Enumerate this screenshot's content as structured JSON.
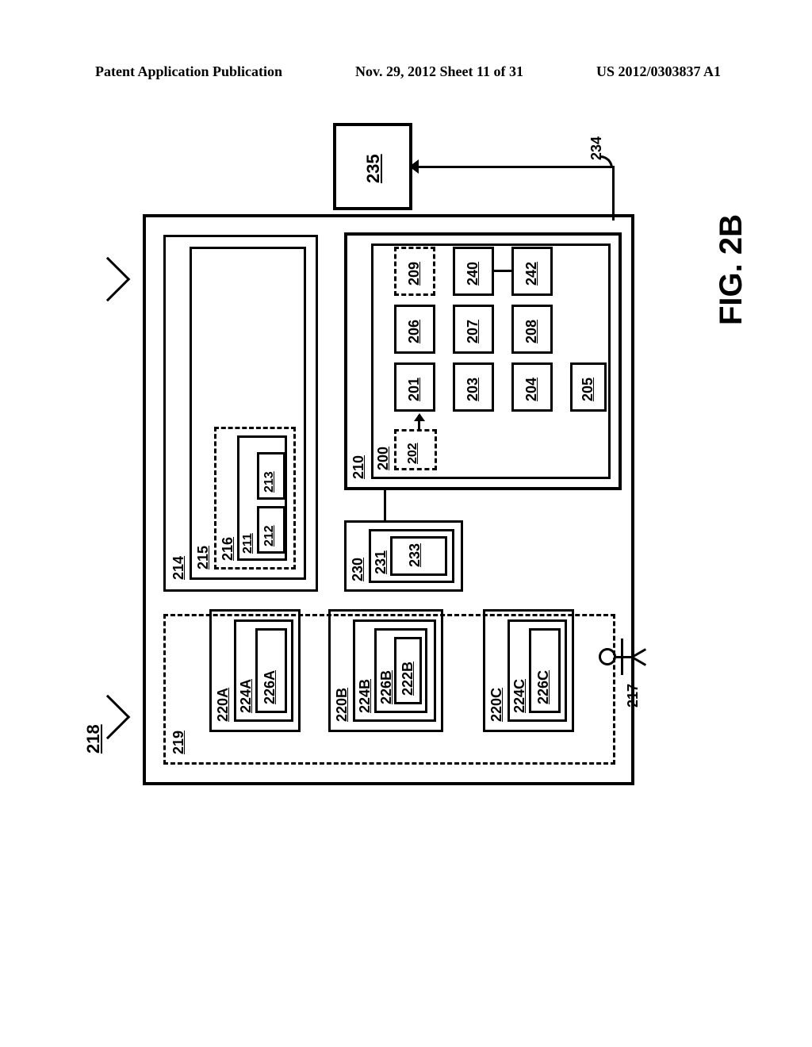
{
  "header": {
    "left": "Patent Application Publication",
    "mid": "Nov. 29, 2012  Sheet 11 of 31",
    "right": "US 2012/0303837 A1"
  },
  "figure": {
    "label": "FIG. 2B",
    "outer": "218",
    "dgroup": "219",
    "boxA": {
      "outer": "220A",
      "mid": "224A",
      "inner": "226A"
    },
    "boxB": {
      "outer": "220B",
      "mid": "224B",
      "inner": "226B",
      "inner2": "222B"
    },
    "boxC": {
      "outer": "220C",
      "mid": "224C",
      "inner": "226C"
    },
    "user": "217",
    "b214": "214",
    "b215": "215",
    "d216": "216",
    "b211": "211",
    "b212": "212",
    "b213": "213",
    "b230": "230",
    "b231": "231",
    "b233": "233",
    "b210": "210",
    "b200": "200",
    "d202": "202",
    "b201": "201",
    "b206": "206",
    "d209": "209",
    "b203": "203",
    "b207": "207",
    "b240": "240",
    "b204": "204",
    "b208": "208",
    "b242": "242",
    "b205": "205",
    "b235": "235",
    "l234": "234"
  }
}
